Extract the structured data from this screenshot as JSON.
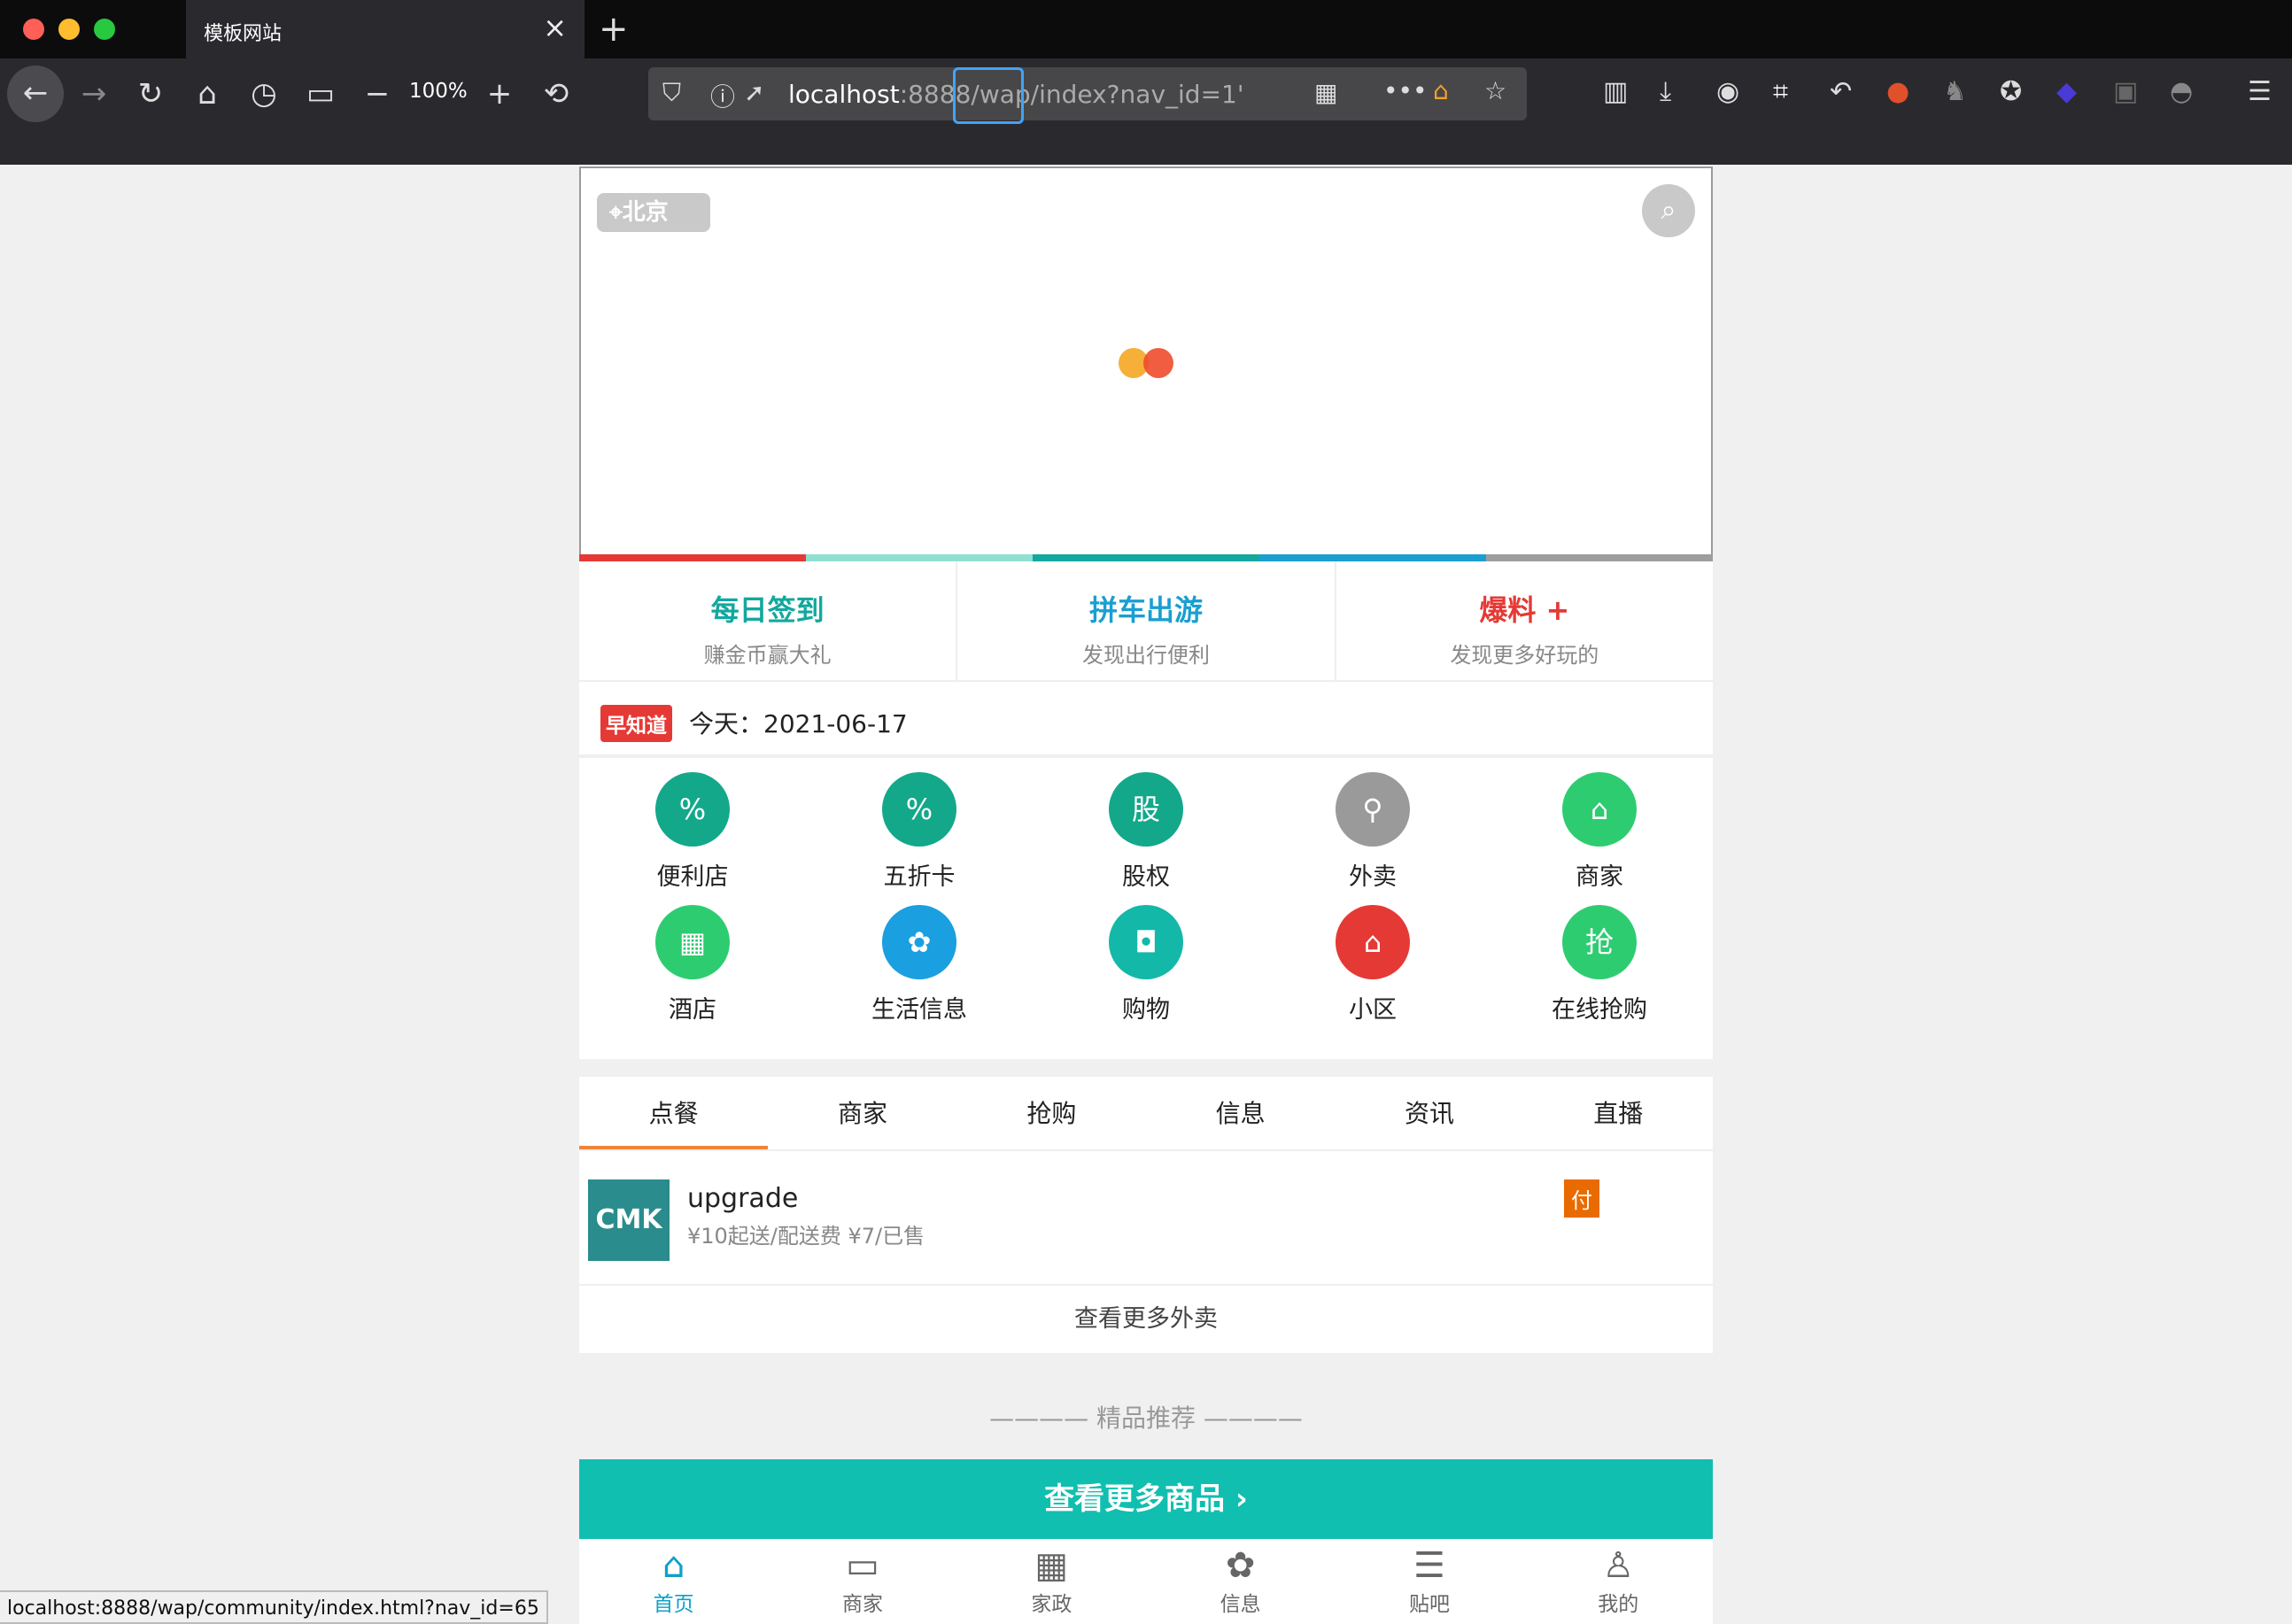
{
  "browser": {
    "tab_title": "模板网站",
    "zoom": "100%",
    "url_host": "localhost",
    "url_rest": ":8888/wap/index?nav_id=1'",
    "status_url": "localhost:8888/wap/community/index.html?nav_id=65"
  },
  "header": {
    "location": "北京"
  },
  "quick_links": [
    {
      "title": "每日签到",
      "subtitle": "赚金币赢大礼",
      "color": "#13a89e"
    },
    {
      "title": "拼车出游",
      "subtitle": "发现出行便利",
      "color": "#1a9fd0"
    },
    {
      "title": "爆料 +",
      "subtitle": "发现更多好玩的",
      "color": "#e53935"
    }
  ],
  "strip_colors": [
    "#e53935",
    "#8fe0d0",
    "#13a89e",
    "#1a9fd0",
    "#9e9e9e"
  ],
  "news": {
    "badge": "早知道",
    "text": "今天：2021-06-17"
  },
  "categories": [
    {
      "label": "便利店",
      "icon": "percent-icon",
      "glyph": "%",
      "color": "#13a88a"
    },
    {
      "label": "五折卡",
      "icon": "percent-icon",
      "glyph": "%",
      "color": "#13a88a"
    },
    {
      "label": "股权",
      "icon": "stock-icon",
      "glyph": "股",
      "color": "#13a88a"
    },
    {
      "label": "外卖",
      "icon": "bike-icon",
      "glyph": "⚲",
      "color": "#9a9a9a"
    },
    {
      "label": "商家",
      "icon": "store-icon",
      "glyph": "⌂",
      "color": "#2ecc71"
    },
    {
      "label": "酒店",
      "icon": "building-icon",
      "glyph": "▦",
      "color": "#2ecc71"
    },
    {
      "label": "生活信息",
      "icon": "info-icon",
      "glyph": "✿",
      "color": "#1a9fe0"
    },
    {
      "label": "购物",
      "icon": "shopping-bag-icon",
      "glyph": "◘",
      "color": "#13b8a8"
    },
    {
      "label": "小区",
      "icon": "house-icon",
      "glyph": "⌂",
      "color": "#e53935"
    },
    {
      "label": "在线抢购",
      "icon": "flash-sale-icon",
      "glyph": "抢",
      "color": "#2ecc71"
    }
  ],
  "tabs": [
    "点餐",
    "商家",
    "抢购",
    "信息",
    "资讯",
    "直播"
  ],
  "listing": {
    "logo_text": "CMK",
    "name": "upgrade",
    "meta": "¥10起送/配送费 ¥7/已售",
    "pay_badge": "付"
  },
  "more_takeout": "查看更多外卖",
  "recommend_title": "———— 精品推荐 ————",
  "more_products": "查看更多商品 ›",
  "bottom_nav": [
    {
      "label": "首页",
      "glyph": "⌂",
      "icon": "home-icon"
    },
    {
      "label": "商家",
      "glyph": "▭",
      "icon": "store-icon"
    },
    {
      "label": "家政",
      "glyph": "▦",
      "icon": "building-icon"
    },
    {
      "label": "信息",
      "glyph": "✿",
      "icon": "info-icon"
    },
    {
      "label": "贴吧",
      "glyph": "☰",
      "icon": "chat-icon"
    },
    {
      "label": "我的",
      "glyph": "♙",
      "icon": "user-icon"
    }
  ]
}
